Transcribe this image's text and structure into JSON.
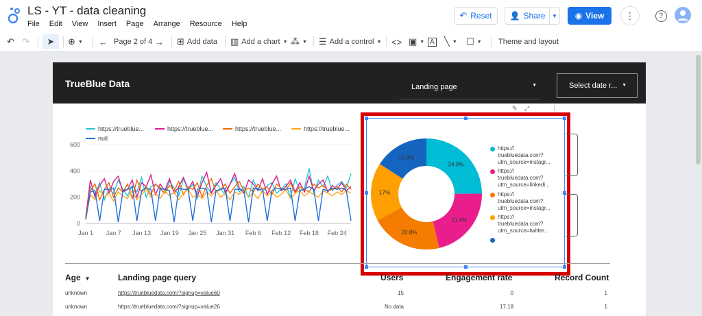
{
  "app": {
    "title": "LS - YT - data cleaning",
    "menus": [
      "File",
      "Edit",
      "View",
      "Insert",
      "Page",
      "Arrange",
      "Resource",
      "Help"
    ],
    "reset_label": "Reset",
    "share_label": "Share",
    "view_label": "View"
  },
  "toolbar": {
    "page_label": "Page 2 of 4",
    "add_data": "Add data",
    "add_chart": "Add a chart",
    "add_control": "Add a control",
    "theme_layout": "Theme and layout"
  },
  "report": {
    "brand": "TrueBlue Data",
    "landing_page_control": "Landing page",
    "date_control": "Select date r..."
  },
  "line_legend": [
    {
      "label": "https://trueblue...",
      "color": "#26c6da"
    },
    {
      "label": "https://trueblue...",
      "color": "#d81b8c"
    },
    {
      "label": "https://trueblue...",
      "color": "#ef6c00"
    },
    {
      "label": "https://trueblue...",
      "color": "#ffa726"
    },
    {
      "label": "null",
      "color": "#1e6fd9"
    }
  ],
  "chart_data": [
    {
      "type": "line",
      "y_ticks": [
        "600",
        "400",
        "200",
        "0"
      ],
      "ylim": [
        0,
        600
      ],
      "x_ticks": [
        "Jan 1",
        "Jan 7",
        "Jan 13",
        "Jan 19",
        "Jan 25",
        "Jan 31",
        "Feb 6",
        "Feb 12",
        "Feb 18",
        "Feb 24"
      ],
      "series": [
        {
          "name": "https://trueblue...",
          "color": "#26c6da",
          "values": [
            50,
            280,
            220,
            310,
            180,
            260,
            230,
            330,
            260,
            210,
            290,
            240,
            350,
            200,
            280,
            300,
            260,
            230,
            320,
            270,
            210,
            340,
            250,
            300,
            190,
            360,
            280,
            230,
            310,
            260,
            220,
            300,
            350,
            240,
            280,
            200,
            330,
            260,
            240,
            290,
            310,
            230,
            260,
            300,
            200,
            340,
            250,
            270,
            420,
            230,
            330,
            280,
            360,
            250,
            290,
            320,
            270,
            380
          ]
        },
        {
          "name": "https://trueblue...",
          "color": "#d81b8c",
          "values": [
            40,
            330,
            200,
            290,
            340,
            230,
            320,
            360,
            240,
            260,
            330,
            200,
            310,
            280,
            370,
            220,
            300,
            250,
            340,
            230,
            280,
            350,
            260,
            320,
            210,
            310,
            390,
            230,
            290,
            340,
            230,
            300,
            380,
            270,
            230,
            330,
            300,
            250,
            340,
            220,
            300,
            360,
            250,
            280,
            330,
            240,
            310,
            240,
            360,
            250,
            300,
            330,
            240,
            290,
            260,
            310,
            250,
            280
          ]
        },
        {
          "name": "https://trueblue...",
          "color": "#ef6c00",
          "values": [
            40,
            250,
            300,
            180,
            260,
            310,
            200,
            270,
            240,
            300,
            190,
            330,
            240,
            280,
            220,
            300,
            270,
            230,
            290,
            250,
            320,
            220,
            280,
            260,
            310,
            200,
            290,
            340,
            240,
            260,
            300,
            230,
            280,
            320,
            250,
            270,
            240,
            300,
            260,
            280,
            220,
            300,
            270,
            250,
            310,
            230,
            280,
            260,
            240,
            300,
            270,
            290,
            250,
            260,
            280,
            240,
            300,
            260
          ]
        },
        {
          "name": "https://trueblue...",
          "color": "#ffa726",
          "values": [
            30,
            220,
            180,
            250,
            200,
            230,
            170,
            240,
            210,
            190,
            250,
            180,
            220,
            260,
            200,
            230,
            190,
            250,
            210,
            240,
            180,
            230,
            260,
            200,
            220,
            190,
            240,
            210,
            250,
            200,
            230,
            180,
            240,
            220,
            260,
            200,
            230,
            190,
            250,
            210,
            240,
            200,
            220,
            260,
            190,
            230,
            250,
            210,
            240,
            220,
            200,
            250,
            230,
            210,
            240,
            220,
            250,
            230
          ]
        },
        {
          "name": "null",
          "color": "#1e6fd9",
          "values": [
            30,
            240,
            250,
            20,
            260,
            260,
            270,
            10,
            250,
            260,
            280,
            20,
            250,
            270,
            260,
            20,
            270,
            260,
            250,
            10,
            270,
            260,
            260,
            20,
            260,
            270,
            260,
            10,
            250,
            260,
            270,
            20,
            260,
            260,
            250,
            10,
            270,
            260,
            260,
            20,
            250,
            270,
            260,
            260,
            270,
            20,
            250,
            260,
            280,
            260,
            20,
            260,
            250,
            270,
            260,
            270,
            250,
            20
          ]
        }
      ]
    },
    {
      "type": "pie",
      "donut": true,
      "slices": [
        {
          "label": "https:// truebluedata.com? utm_source=instagr...",
          "value": 24.9,
          "text": "24.9%",
          "color": "#00bcd4"
        },
        {
          "label": "https:// truebluedata.com? utm_source=linkedi...",
          "value": 21.4,
          "text": "21.4%",
          "color": "#e91e8c"
        },
        {
          "label": "https:// truebluedata.com? utm_source=instagr...",
          "value": 20.8,
          "text": "20.8%",
          "color": "#f57c00"
        },
        {
          "label": "https:// truebluedata.com? utm_source=twitter...",
          "value": 17.0,
          "text": "17%",
          "color": "#ffa000"
        },
        {
          "label": "",
          "value": 15.9,
          "text": "15.9%",
          "color": "#1565c0"
        }
      ]
    }
  ],
  "table": {
    "headers": {
      "age": "Age",
      "query": "Landing page query",
      "users": "Users",
      "engagement": "Engagement rate",
      "records": "Record Count"
    },
    "rows": [
      {
        "age": "unknown",
        "query": "https://truebluedata.com/?signup=value60",
        "users": "15",
        "engagement": "0",
        "records": "1"
      },
      {
        "age": "unknown",
        "query": "https://truebluedata.com/?signup=value26",
        "users": "No data",
        "engagement": "17.18",
        "records": "1"
      }
    ]
  }
}
